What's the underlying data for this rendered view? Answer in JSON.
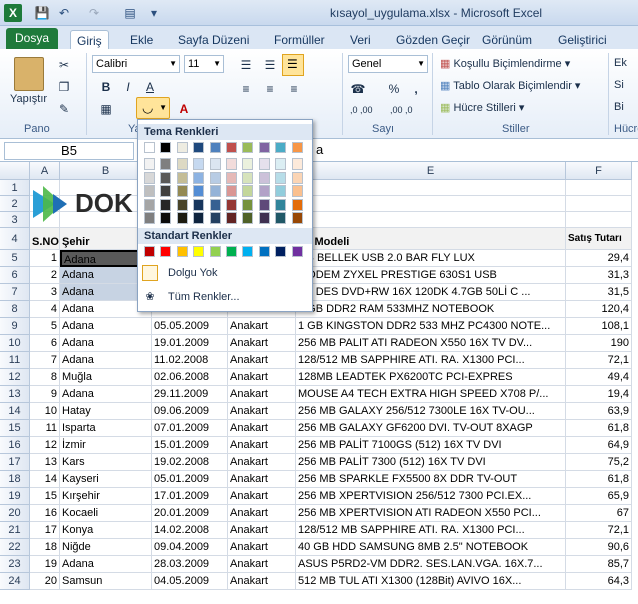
{
  "window": {
    "title": "kısayol_uygulama.xlsx - Microsoft Excel",
    "app_icon": "X"
  },
  "tabs": [
    "Dosya",
    "Giriş",
    "Ekle",
    "Sayfa Düzeni",
    "Formüller",
    "Veri",
    "Gözden Geçir",
    "Görünüm",
    "Geliştirici"
  ],
  "ribbon": {
    "paste_label": "Yapıştır",
    "pano_label": "Pano",
    "font_name": "Calibri",
    "font_size": "11",
    "number_format": "Genel",
    "number_group_label": "Sayı",
    "styles_group_label": "Stiller",
    "cells_group_label": "Hücre",
    "conditional_formatting": "Koşullu Biçimlendirme",
    "format_as_table": "Tablo Olarak Biçimlendir",
    "cell_styles": "Hücre Stilleri",
    "font_group_label_fragment": "Ya",
    "cells_frag_1": "Ek",
    "cells_frag_2": "Si",
    "cells_frag_3": "Bi",
    "comma": ",",
    "dec_inc": ",0 ,00",
    "dec_dec": ",00 ,0"
  },
  "formula_bar": {
    "name_box": "B5",
    "content_fragment": "a"
  },
  "palette": {
    "theme_title": "Tema Renkleri",
    "standard_title": "Standart Renkler",
    "no_fill": "Dolgu Yok",
    "more_colors": "Tüm Renkler...",
    "theme_top": [
      "#ffffff",
      "#000000",
      "#eeece1",
      "#1f497d",
      "#4f81bd",
      "#c0504d",
      "#9bbb59",
      "#8064a2",
      "#4bacc6",
      "#f79646"
    ],
    "theme_shades": [
      [
        "#f2f2f2",
        "#7f7f7f",
        "#ddd9c3",
        "#c6d9f0",
        "#dbe5f1",
        "#f2dcdb",
        "#ebf1dd",
        "#e5e0ec",
        "#dbeef3",
        "#fdeada"
      ],
      [
        "#d8d8d8",
        "#595959",
        "#c4bd97",
        "#8db3e2",
        "#b8cce4",
        "#e5b9b7",
        "#d7e3bc",
        "#ccc1d9",
        "#b7dde8",
        "#fbd5b5"
      ],
      [
        "#bfbfbf",
        "#3f3f3f",
        "#938953",
        "#548dd4",
        "#95b3d7",
        "#d99694",
        "#c3d69b",
        "#b2a2c7",
        "#92cddc",
        "#fac08f"
      ],
      [
        "#a5a5a5",
        "#262626",
        "#494429",
        "#17365d",
        "#366092",
        "#953734",
        "#76923c",
        "#5f497a",
        "#31859b",
        "#e36c09"
      ],
      [
        "#7f7f7f",
        "#0c0c0c",
        "#1d1b10",
        "#0f243e",
        "#244061",
        "#632423",
        "#4f6128",
        "#3f3151",
        "#205867",
        "#974806"
      ]
    ],
    "standard": [
      "#c00000",
      "#ff0000",
      "#ffc000",
      "#ffff00",
      "#92d050",
      "#00b050",
      "#00b0f0",
      "#0070c0",
      "#002060",
      "#7030a0"
    ]
  },
  "columns": [
    "A",
    "B",
    "C",
    "D",
    "E",
    "F"
  ],
  "header_row": {
    "sno": "S.NO",
    "city": "Şehir",
    "model": "ün Modeli",
    "amount": "Satış Tutarı"
  },
  "logo_text": "DOK",
  "rows": [
    {
      "r": "5",
      "sno": "1",
      "city": "Adana",
      "date": "",
      "cat": "",
      "model": "GB BELLEK USB 2.0 BAR FLY LUX",
      "amt": "29,4"
    },
    {
      "r": "6",
      "sno": "2",
      "city": "Adana",
      "date": "",
      "cat": "",
      "model": "MODEM ZYXEL PRESTIGE 630S1 USB",
      "amt": "31,3"
    },
    {
      "r": "7",
      "sno": "3",
      "city": "Adana",
      "date": "",
      "cat": "",
      "model": "ES DES DVD+RW 16X 120DK 4.7GB 50Lİ C ...",
      "amt": "31,5"
    },
    {
      "r": "8",
      "sno": "4",
      "city": "Adana",
      "date": "29.05.2009",
      "cat": "Anakart",
      "model": "1 GB DDR2 RAM 533MHZ NOTEBOOK",
      "amt": "120,4"
    },
    {
      "r": "9",
      "sno": "5",
      "city": "Adana",
      "date": "05.05.2009",
      "cat": "Anakart",
      "model": "1 GB KINGSTON DDR2 533 MHZ PC4300 NOTE...",
      "amt": "108,1"
    },
    {
      "r": "10",
      "sno": "6",
      "city": "Adana",
      "date": "19.01.2009",
      "cat": "Anakart",
      "model": "256 MB PALIT ATI RADEON X550 16X TV DV...",
      "amt": "190"
    },
    {
      "r": "11",
      "sno": "7",
      "city": "Adana",
      "date": "11.02.2008",
      "cat": "Anakart",
      "model": "128/512 MB SAPPHIRE ATI. RA. X1300 PCI...",
      "amt": "72,1"
    },
    {
      "r": "12",
      "sno": "8",
      "city": "Muğla",
      "date": "02.06.2008",
      "cat": "Anakart",
      "model": "128MB LEADTEK PX6200TC PCI-EXPRES",
      "amt": "49,4"
    },
    {
      "r": "13",
      "sno": "9",
      "city": "Adana",
      "date": "29.11.2009",
      "cat": "Anakart",
      "model": "MOUSE A4 TECH EXTRA HIGH SPEED X708 P/...",
      "amt": "19,4"
    },
    {
      "r": "14",
      "sno": "10",
      "city": "Hatay",
      "date": "09.06.2009",
      "cat": "Anakart",
      "model": "256 MB GALAXY 256/512 7300LE 16X TV-OU...",
      "amt": "63,9"
    },
    {
      "r": "15",
      "sno": "11",
      "city": "Isparta",
      "date": "07.01.2009",
      "cat": "Anakart",
      "model": "256 MB GALAXY GF6200 DVI. TV-OUT 8XAGP",
      "amt": "61,8"
    },
    {
      "r": "16",
      "sno": "12",
      "city": "İzmir",
      "date": "15.01.2009",
      "cat": "Anakart",
      "model": "256 MB PALİT 7100GS (512) 16X TV DVI",
      "amt": "64,9"
    },
    {
      "r": "17",
      "sno": "13",
      "city": "Kars",
      "date": "19.02.2008",
      "cat": "Anakart",
      "model": "256 MB PALİT 7300 (512) 16X TV DVI",
      "amt": "75,2"
    },
    {
      "r": "18",
      "sno": "14",
      "city": "Kayseri",
      "date": "05.01.2009",
      "cat": "Anakart",
      "model": "256 MB SPARKLE FX5500 8X DDR TV-OUT",
      "amt": "61,8"
    },
    {
      "r": "19",
      "sno": "15",
      "city": "Kırşehir",
      "date": "17.01.2009",
      "cat": "Anakart",
      "model": "256 MB XPERTVISION 256/512 7300 PCI.EX...",
      "amt": "65,9"
    },
    {
      "r": "20",
      "sno": "16",
      "city": "Kocaeli",
      "date": "20.01.2009",
      "cat": "Anakart",
      "model": "256 MB XPERTVISION ATI RADEON X550 PCI...",
      "amt": "67"
    },
    {
      "r": "21",
      "sno": "17",
      "city": "Konya",
      "date": "14.02.2008",
      "cat": "Anakart",
      "model": "128/512 MB SAPPHIRE ATI. RA. X1300 PCI...",
      "amt": "72,1"
    },
    {
      "r": "22",
      "sno": "18",
      "city": "Niğde",
      "date": "09.04.2009",
      "cat": "Anakart",
      "model": "40 GB HDD SAMSUNG 8MB 2.5\" NOTEBOOK",
      "amt": "90,6"
    },
    {
      "r": "23",
      "sno": "19",
      "city": "Adana",
      "date": "28.03.2009",
      "cat": "Anakart",
      "model": "ASUS P5RD2-VM DDR2. SES.LAN.VGA. 16X.7...",
      "amt": "85,7"
    },
    {
      "r": "24",
      "sno": "20",
      "city": "Samsun",
      "date": "04.05.2009",
      "cat": "Anakart",
      "model": "512 MB TUL ATI X1300 (128Bit) AVIVO 16X...",
      "amt": "64,3"
    }
  ],
  "empty_rows": [
    "1",
    "2",
    "3"
  ],
  "header_row_num": "4"
}
